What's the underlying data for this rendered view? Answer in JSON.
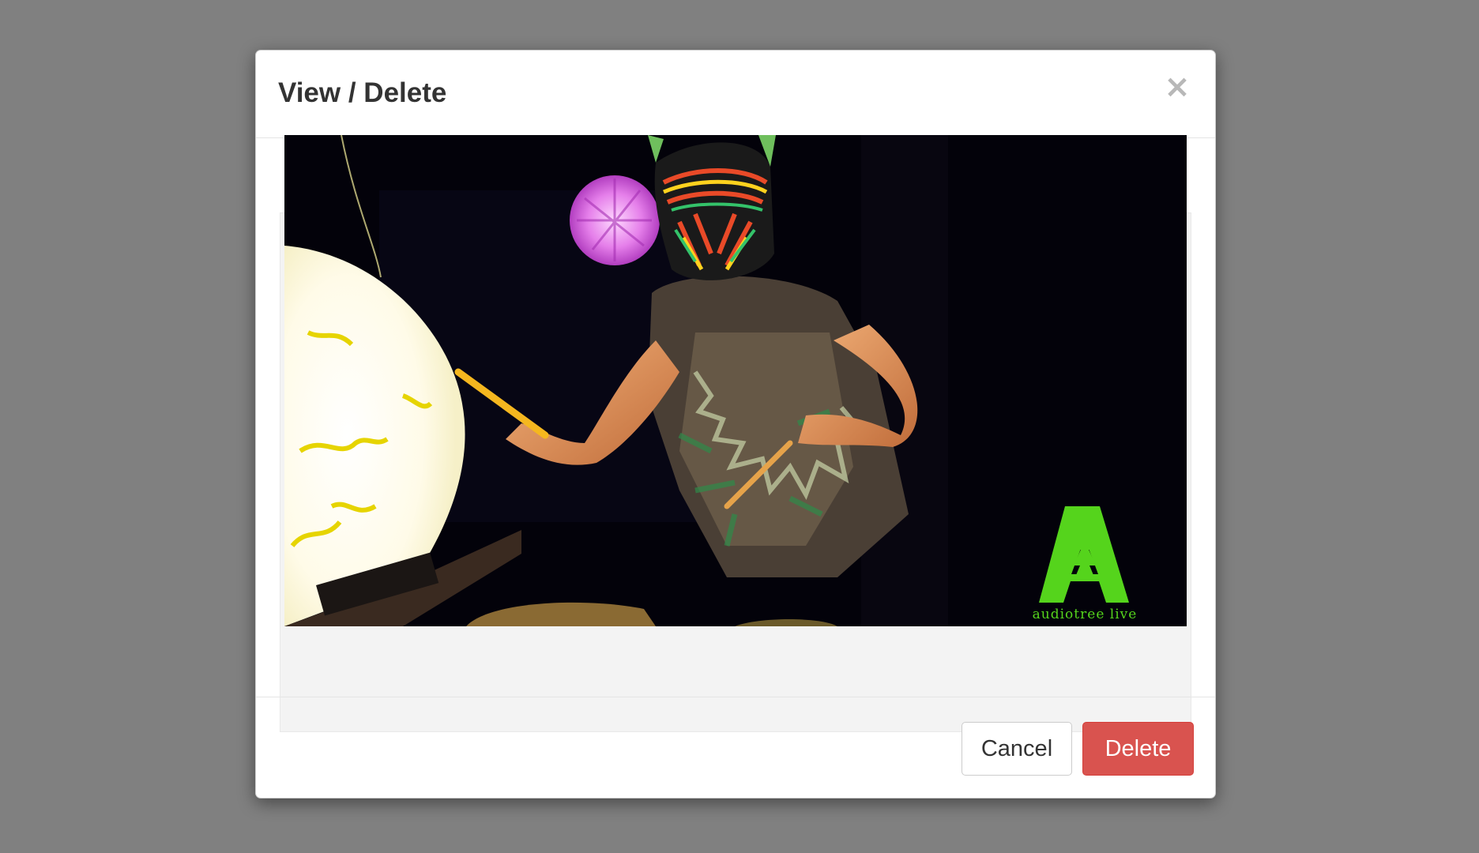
{
  "modal": {
    "title": "View / Delete",
    "close_symbol": "×",
    "close_icon": "close-icon"
  },
  "media": {
    "watermark_text": "audiotree live",
    "watermark_letter": "A",
    "watermark_color": "#55d41c"
  },
  "footer": {
    "cancel_label": "Cancel",
    "delete_label": "Delete"
  },
  "colors": {
    "backdrop": "#808080",
    "danger": "#d9534f",
    "title_text": "#333333"
  }
}
